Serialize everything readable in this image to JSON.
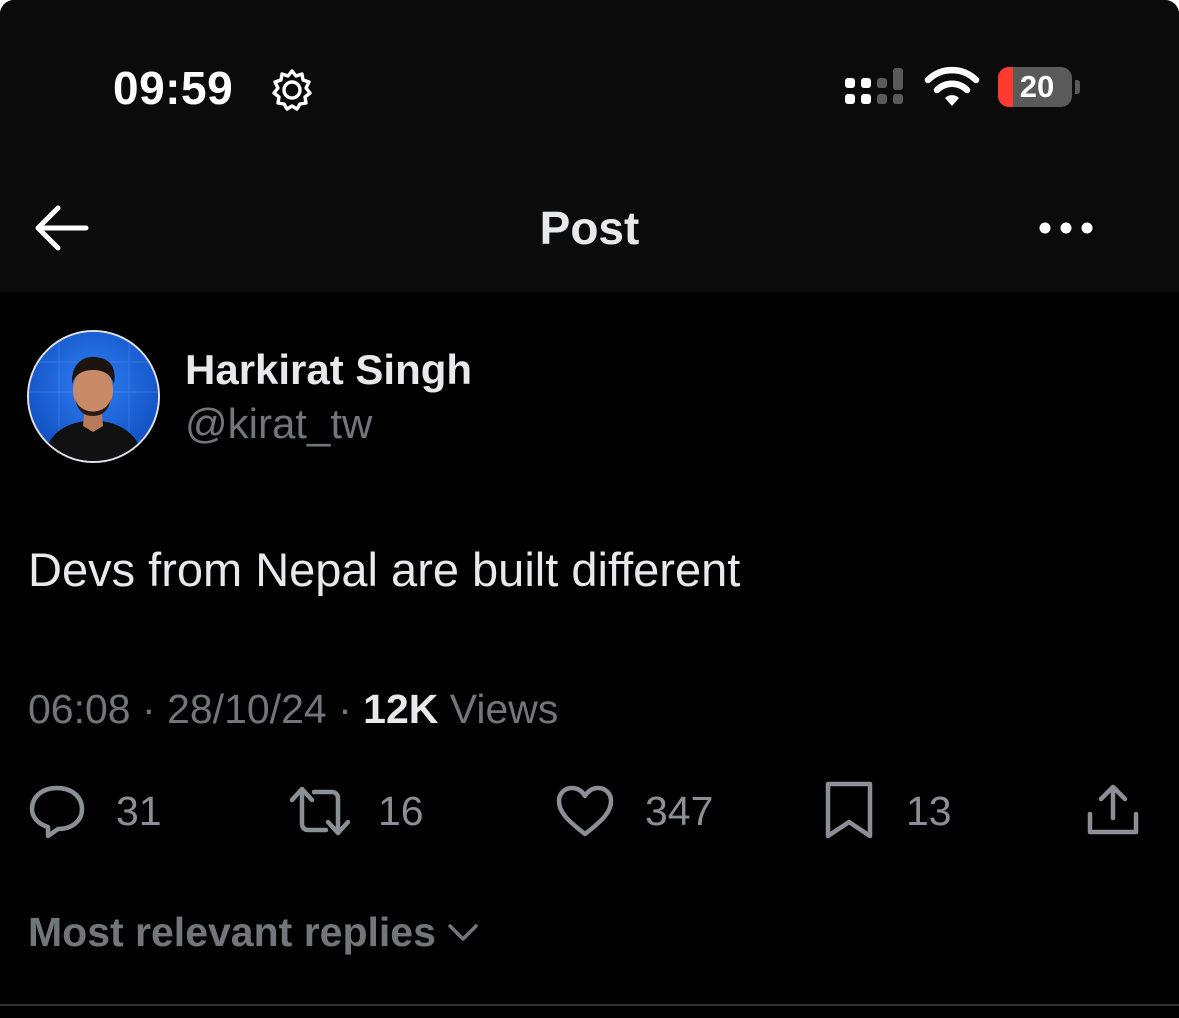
{
  "status_bar": {
    "time": "09:59",
    "battery_level": "20",
    "battery_fraction": 0.2
  },
  "header": {
    "title": "Post"
  },
  "author": {
    "name": "Harkirat Singh",
    "handle": "@kirat_tw"
  },
  "post": {
    "text": "Devs from Nepal are built different",
    "time": "06:08",
    "date": "28/10/24",
    "separator": "·",
    "views_count": "12K",
    "views_label": "Views"
  },
  "actions": {
    "replies": "31",
    "reposts": "16",
    "likes": "347",
    "bookmarks": "13"
  },
  "replies_sort": {
    "label": "Most relevant replies"
  },
  "colors": {
    "background": "#000000",
    "topbar": "#0b0b0b",
    "primary_text": "#e7e9ea",
    "secondary_text": "#71767b",
    "battery_low": "#ff3b30",
    "avatar_bg": "#1a5fd6"
  },
  "icons": {
    "back": "arrow-left-icon",
    "more": "more-dots-icon",
    "reply": "reply-bubble-icon",
    "repost": "repost-icon",
    "like": "heart-icon",
    "bookmark": "bookmark-icon",
    "share": "share-icon",
    "chevron": "chevron-down-icon",
    "status_gear": "gear-icon",
    "signal": "signal-icon",
    "wifi": "wifi-icon"
  }
}
